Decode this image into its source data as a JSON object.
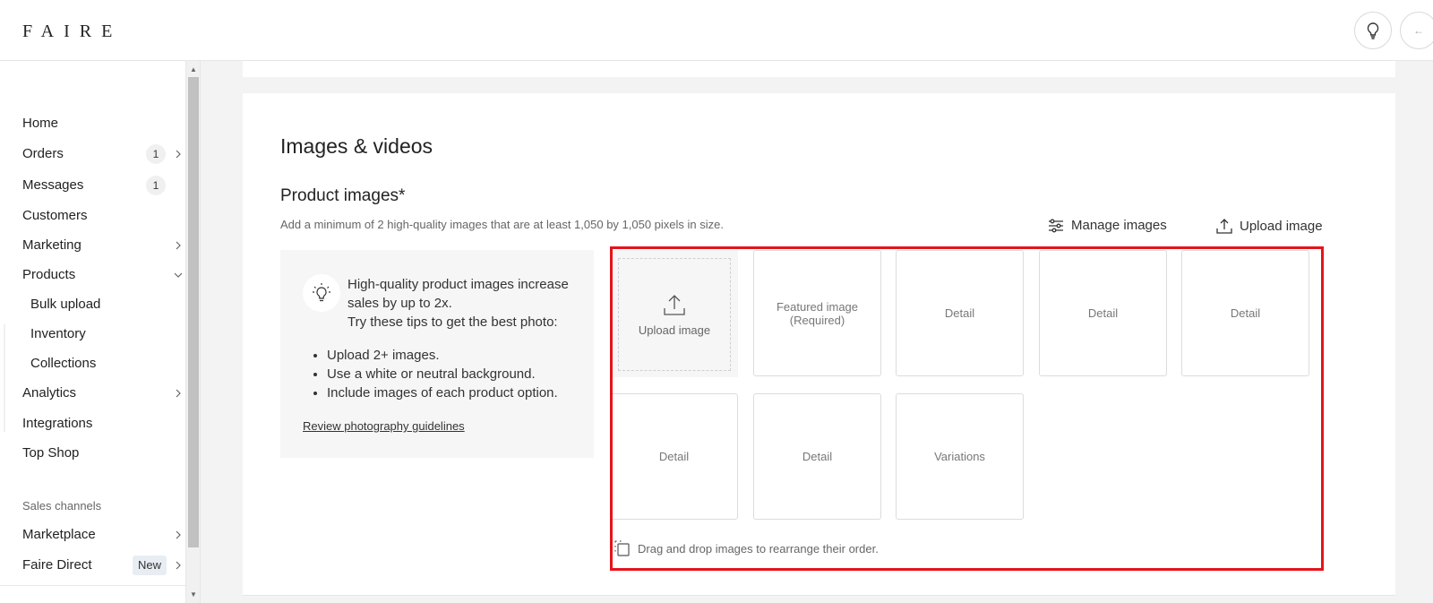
{
  "brand": {
    "logo": "FAIRE"
  },
  "sidebar": {
    "items": [
      {
        "label": "Home"
      },
      {
        "label": "Orders",
        "badge": "1"
      },
      {
        "label": "Messages",
        "badge": "1"
      },
      {
        "label": "Customers"
      },
      {
        "label": "Marketing"
      },
      {
        "label": "Products"
      },
      {
        "label": "Bulk upload"
      },
      {
        "label": "Inventory"
      },
      {
        "label": "Collections"
      },
      {
        "label": "Analytics"
      },
      {
        "label": "Integrations"
      },
      {
        "label": "Top Shop"
      }
    ],
    "section_title": "Sales channels",
    "channels": [
      {
        "label": "Marketplace"
      },
      {
        "label": "Faire Direct",
        "badge": "New"
      }
    ]
  },
  "main": {
    "title": "Images & videos",
    "subtitle": "Product images*",
    "hint": "Add a minimum of 2 high-quality images that are at least 1,050 by 1,050 pixels in size.",
    "actions": {
      "manage": "Manage images",
      "upload": "Upload image"
    },
    "tips": {
      "line1": "High-quality product images increase sales by up to 2x.",
      "line2": "Try these tips to get the best photo:",
      "bullets": [
        "Upload 2+ images.",
        "Use a white or neutral background.",
        "Include images of each product option."
      ],
      "link": "Review photography guidelines"
    },
    "upload_tile": "Upload image",
    "slots": [
      "Featured image (Required)",
      "Detail",
      "Detail",
      "Detail",
      "Detail",
      "Detail",
      "Variations"
    ],
    "drag_hint": "Drag and drop images to rearrange their order."
  },
  "colors": {
    "highlight": "#e5141b",
    "text": "#333333",
    "muted": "#777777"
  }
}
